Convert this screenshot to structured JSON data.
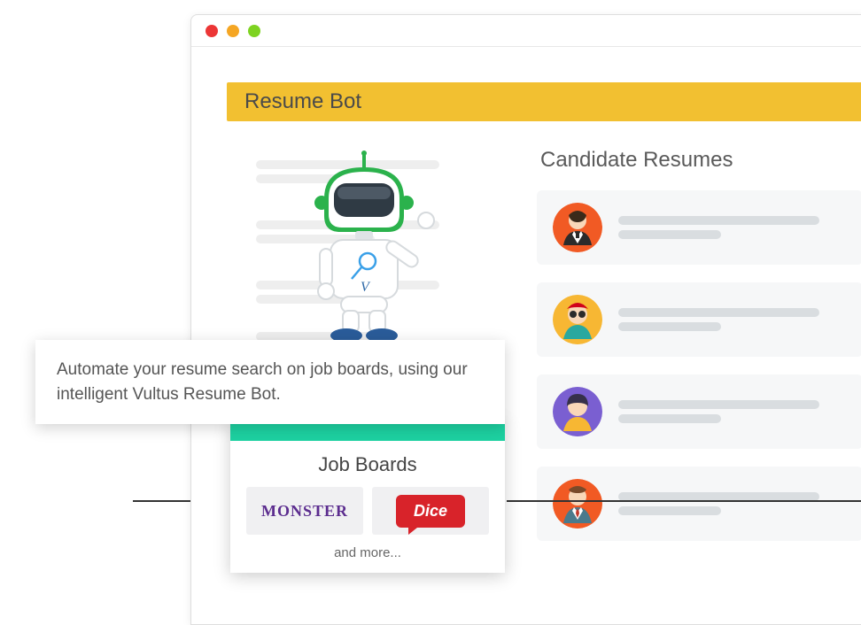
{
  "header": {
    "title": "Resume Bot"
  },
  "description": "Automate your resume search on job boards, using our intelligent Vultus Resume Bot.",
  "jobboards": {
    "title": "Job Boards",
    "boards": {
      "monster": "MONSTER",
      "dice": "Dice"
    },
    "more": "and more..."
  },
  "candidates": {
    "title": "Candidate Resumes"
  }
}
